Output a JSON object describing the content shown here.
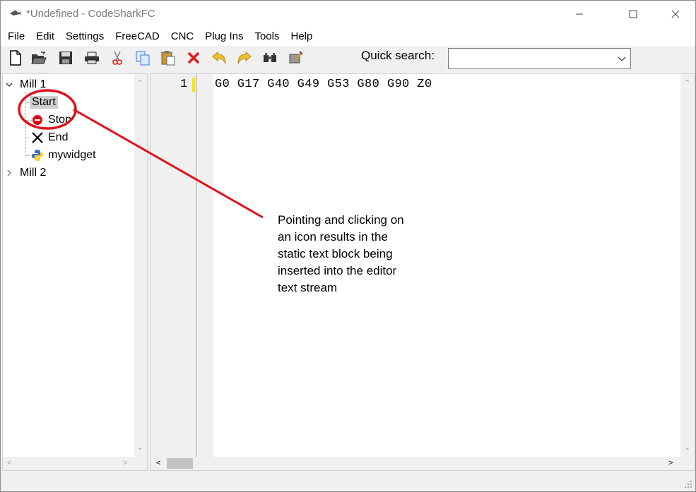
{
  "window": {
    "title": "*Undefined - CodeSharkFC",
    "controls": {
      "minimize": "minimize-icon",
      "maximize": "maximize-icon",
      "close": "close-icon"
    }
  },
  "menu": [
    "File",
    "Edit",
    "Settings",
    "FreeCAD",
    "CNC",
    "Plug Ins",
    "Tools",
    "Help"
  ],
  "toolbar": {
    "buttons": [
      "new-file-icon",
      "open-folder-icon",
      "save-icon",
      "print-icon",
      "cut-icon",
      "copy-icon",
      "paste-icon",
      "delete-icon",
      "undo-icon",
      "redo-icon",
      "find-icon",
      "settings-wrench-icon"
    ],
    "quick_search_label": "Quick search:",
    "quick_search_value": ""
  },
  "tree": {
    "groups": [
      {
        "label": "Mill 1",
        "expanded": true,
        "items": [
          {
            "label": "Start",
            "icon": "none",
            "selected": true
          },
          {
            "label": "Stop",
            "icon": "red-stop-icon"
          },
          {
            "label": "End",
            "icon": "black-x-icon"
          },
          {
            "label": "mywidget",
            "icon": "python-icon"
          }
        ]
      },
      {
        "label": "Mill 2",
        "expanded": false,
        "items": []
      }
    ]
  },
  "editor": {
    "line_number": "1",
    "code": "G0 G17 G40 G49 G53 G80 G90 Z0",
    "caret_marker_color": "#f5e800"
  },
  "annotation": {
    "lines": [
      "Pointing and clicking on",
      "an icon results in the",
      "static text block being",
      "inserted into the editor",
      "text stream"
    ],
    "color": "#e0101c"
  }
}
